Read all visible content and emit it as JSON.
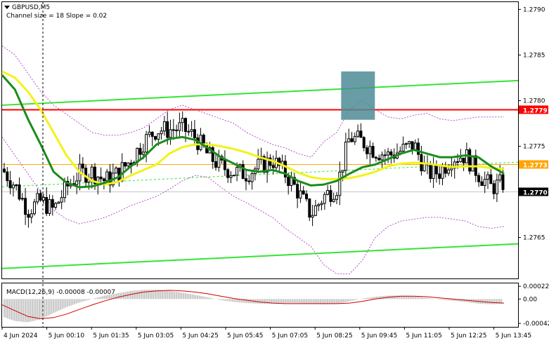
{
  "chart_data": {
    "type": "candlestick",
    "symbol_label": "GBPUSD,M5",
    "indicator_label": "Channel size = 18 Slope = 0.02",
    "macd_label": "MACD(12,26,9) -0.00008 -0.00007",
    "main_axis": {
      "ylim": [
        1.27605,
        1.27908
      ],
      "ticks": [
        "1.2790",
        "1.2785",
        "1.2780",
        "1.2775",
        "1.2765"
      ]
    },
    "price_markers": [
      {
        "label": "1.2779",
        "value": 1.2779,
        "color": "#ff0000"
      },
      {
        "label": "1.2773",
        "value": 1.2773,
        "color": "#ffa500"
      },
      {
        "label": "1.2770",
        "value": 1.277,
        "color": "#000000"
      }
    ],
    "macd_axis": {
      "ylim": [
        -0.00048,
        0.00027
      ],
      "ticks": [
        "0.00022",
        "0.00",
        "-0.00042"
      ]
    },
    "x_ticks": [
      "4 Jun 2024",
      "5 Jun 00:10",
      "5 Jun 01:35",
      "5 Jun 03:05",
      "5 Jun 04:25",
      "5 Jun 05:45",
      "5 Jun 07:05",
      "5 Jun 08:25",
      "5 Jun 09:45",
      "5 Jun 11:05",
      "5 Jun 12:25",
      "5 Jun 13:45"
    ],
    "channel": {
      "upper": {
        "start": 1.27795,
        "end": 1.27822
      },
      "lower": {
        "start": 1.27616,
        "end": 1.27643
      }
    },
    "colors": {
      "candles": "#000000",
      "ma_fast": "#1a8c1a",
      "ma_slow": "#f2f21a",
      "channel": "#33e533",
      "envelope": "#b450c8",
      "highlight": "#4d8c96",
      "macd_hist": "#bcbcbc",
      "macd_signal": "#cc0000"
    },
    "series": {
      "close_anchors": [
        1.27725,
        1.27707,
        1.2768,
        1.2769,
        1.2768,
        1.27705,
        1.2772,
        1.27722,
        1.27712,
        1.2772,
        1.27735,
        1.27755,
        1.27768,
        1.27768,
        1.2777,
        1.2776,
        1.2774,
        1.27728,
        1.27722,
        1.2772,
        1.27728,
        1.27735,
        1.2772,
        1.277,
        1.27675,
        1.27695,
        1.27705,
        1.2776,
        1.27755,
        1.27745,
        1.2774,
        1.27745,
        1.27752,
        1.2772,
        1.27722,
        1.27738,
        1.2774,
        1.2772,
        1.27705,
        1.2771
      ],
      "ma_fast": [
        1.27828,
        1.27812,
        1.2778,
        1.27752,
        1.27722,
        1.2771,
        1.27705,
        1.27706,
        1.2771,
        1.27716,
        1.27728,
        1.27738,
        1.27752,
        1.27758,
        1.2776,
        1.27757,
        1.27748,
        1.27738,
        1.27731,
        1.27724,
        1.27722,
        1.27724,
        1.2772,
        1.27712,
        1.27707,
        1.27708,
        1.27712,
        1.2772,
        1.27727,
        1.2773,
        1.27736,
        1.27742,
        1.27746,
        1.27742,
        1.27738,
        1.27738,
        1.2774,
        1.27738,
        1.27728,
        1.2772
      ],
      "ma_slow": [
        1.27832,
        1.27825,
        1.2781,
        1.2779,
        1.27765,
        1.2774,
        1.27722,
        1.27712,
        1.27708,
        1.27711,
        1.27718,
        1.27724,
        1.2773,
        1.27742,
        1.27749,
        1.27752,
        1.27752,
        1.2775,
        1.27747,
        1.27743,
        1.27738,
        1.27734,
        1.27728,
        1.27721,
        1.27716,
        1.27714,
        1.27714,
        1.27715,
        1.27718,
        1.27722,
        1.27728,
        1.27731,
        1.27732,
        1.27731,
        1.27729,
        1.27727,
        1.27728,
        1.27728,
        1.27726,
        1.27725
      ],
      "env_upper": [
        1.2786,
        1.2785,
        1.2783,
        1.2781,
        1.27795,
        1.27785,
        1.27775,
        1.27765,
        1.27762,
        1.27762,
        1.27765,
        1.2777,
        1.2778,
        1.2779,
        1.27795,
        1.2779,
        1.27785,
        1.2778,
        1.27775,
        1.27765,
        1.27758,
        1.27752,
        1.27748,
        1.27742,
        1.27738,
        1.27755,
        1.27765,
        1.2779,
        1.278,
        1.2779,
        1.27782,
        1.2778,
        1.27784,
        1.27786,
        1.2778,
        1.27778,
        1.2778,
        1.27782,
        1.27782,
        1.27782
      ],
      "env_lower": [
        1.2776,
        1.2774,
        1.2772,
        1.277,
        1.2768,
        1.2767,
        1.27665,
        1.27668,
        1.27672,
        1.27678,
        1.27685,
        1.2769,
        1.27695,
        1.27703,
        1.27712,
        1.27718,
        1.27716,
        1.27705,
        1.27695,
        1.27688,
        1.2768,
        1.27672,
        1.2766,
        1.2765,
        1.2764,
        1.2762,
        1.2761,
        1.2761,
        1.27625,
        1.2765,
        1.27662,
        1.27668,
        1.2767,
        1.27672,
        1.27672,
        1.2767,
        1.27668,
        1.27662,
        1.2766,
        1.27662
      ],
      "macd_hist": [
        -0.0003,
        -0.00038,
        -0.0004,
        -0.00035,
        -0.00024,
        -0.00014,
        -6e-05,
        0.0,
        6e-05,
        0.0001,
        0.00014,
        0.00016,
        0.00016,
        0.00014,
        0.00011,
        7e-05,
        3e-05,
        -2e-05,
        -5e-05,
        -7e-05,
        -8e-05,
        -8e-05,
        -7e-05,
        -7e-05,
        -8e-05,
        -9e-05,
        -8e-05,
        -4e-05,
        1e-05,
        4e-05,
        6e-05,
        6e-05,
        5e-05,
        2e-05,
        -1e-05,
        -3e-05,
        -5e-05,
        -8e-05,
        -9e-05,
        -8e-05
      ],
      "macd_signal": [
        -0.0001,
        -0.0002,
        -0.0003,
        -0.00034,
        -0.00032,
        -0.00026,
        -0.00018,
        -0.0001,
        -3e-05,
        3e-05,
        8e-05,
        0.00012,
        0.00014,
        0.00015,
        0.00014,
        0.00012,
        9e-05,
        5e-05,
        1e-05,
        -2e-05,
        -5e-05,
        -7e-05,
        -8e-05,
        -8e-05,
        -8e-05,
        -8e-05,
        -8e-05,
        -7e-05,
        -4e-05,
        0.0,
        3e-05,
        5e-05,
        5e-05,
        4e-05,
        2e-05,
        0.0,
        -2e-05,
        -4e-05,
        -6e-05,
        -7e-05
      ]
    }
  }
}
